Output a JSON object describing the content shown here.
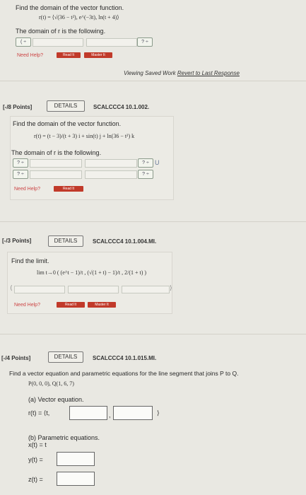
{
  "q1": {
    "title": "Find the domain of the vector function.",
    "formula": "r(t) = ⟨√(36 − t²), e^(−3t), ln(t + 4)⟩",
    "domain_label": "The domain of r is the following.",
    "select_left": "( ÷",
    "select_right": "? ÷",
    "help_label": "Need Help?",
    "btn_read": "Read It",
    "btn_master": "Master It"
  },
  "saved_bar": {
    "viewing": "Viewing Saved Work",
    "revert": "Revert to Last Response"
  },
  "q2": {
    "points": "[-/8 Points]",
    "details": "DETAILS",
    "code": "SCALCCC4 10.1.002.",
    "title": "Find the domain of the vector function.",
    "formula": "r(t) = (t − 3)/(t + 3) i + sin(t) j + ln(36 − t²) k",
    "domain_label": "The domain of r is the following.",
    "select_a": "? ÷",
    "select_b": "? ÷",
    "select_c": "? ÷",
    "select_d": "? ÷",
    "union": "U",
    "help_label": "Need Help?",
    "btn_read": "Read It"
  },
  "q3": {
    "points": "[-/3 Points]",
    "details": "DETAILS",
    "code": "SCALCCC4 10.1.004.MI.",
    "title": "Find the limit.",
    "formula": "lim t→0 ( (e^t − 1)/t , (√(1 + t) − 1)/t , 2/(1 + t) )",
    "open": "⟨",
    "close": "⟩",
    "help_label": "Need Help?",
    "btn_read": "Read It",
    "btn_master": "Master It"
  },
  "q4": {
    "points": "[-/4 Points]",
    "details": "DETAILS",
    "code": "SCALCCC4 10.1.015.MI.",
    "title": "Find a vector equation and parametric equations for the line segment that joins P to Q.",
    "points_pq": "P(0, 0, 0), Q(1, 6, 7)",
    "part_a": "(a) Vector equation.",
    "vec_prefix": "r(t) = ⟨t,",
    "comma": ",",
    "vec_close": "⟩",
    "part_b": "(b) Parametric equations.",
    "x_eq": "x(t) = t",
    "y_label": "y(t) =",
    "z_label": "z(t) ="
  }
}
